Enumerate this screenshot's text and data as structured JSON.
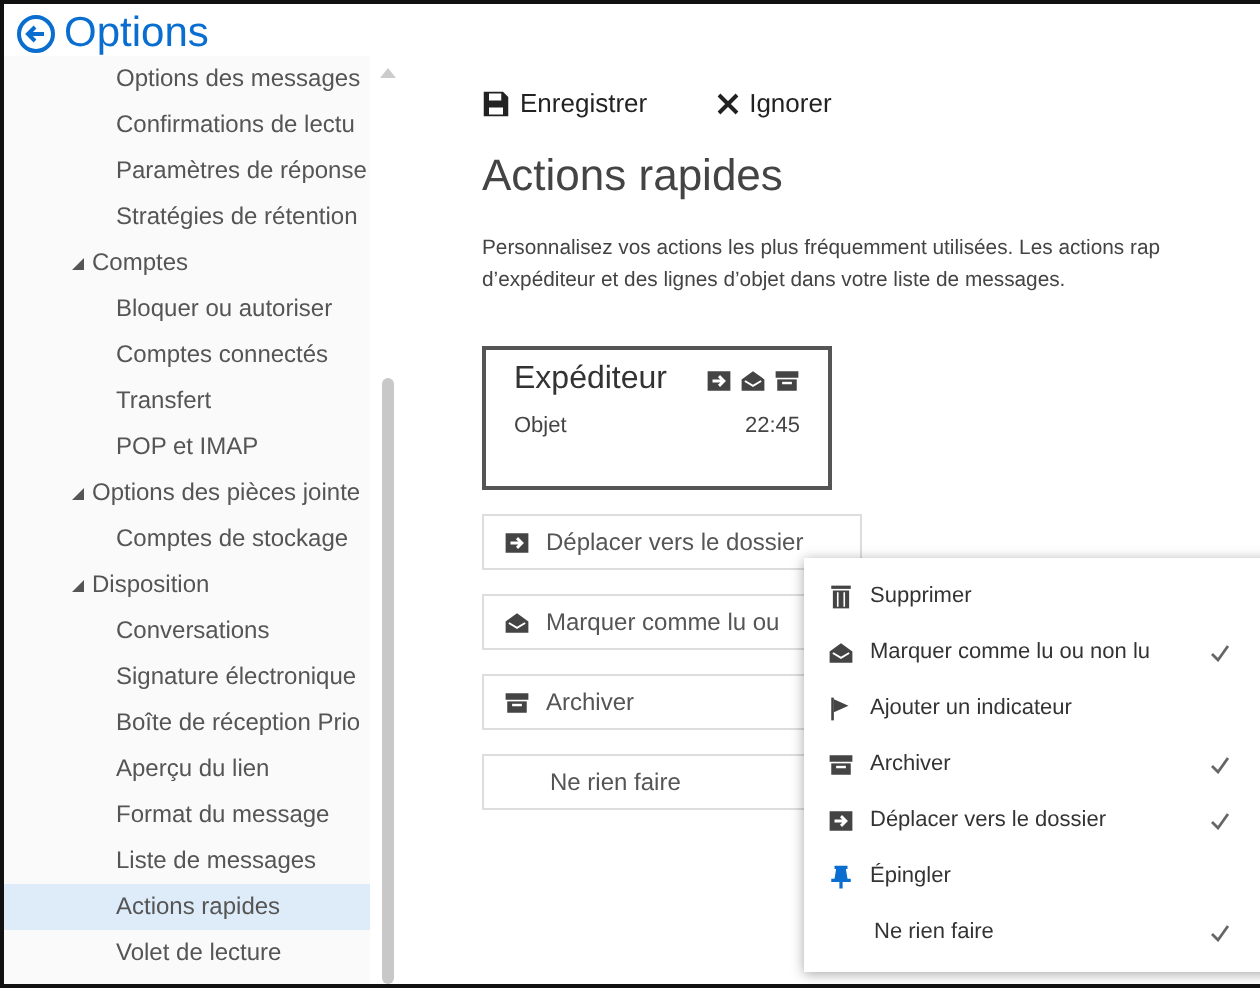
{
  "header": {
    "title": "Options"
  },
  "sidebar": {
    "items": [
      {
        "children": [
          {
            "label": "Options des messages",
            "selected": false
          },
          {
            "label": "Confirmations de lectu",
            "selected": false
          },
          {
            "label": "Paramètres de réponse",
            "selected": false
          },
          {
            "label": "Stratégies de rétention",
            "selected": false
          }
        ]
      },
      {
        "label": "Comptes",
        "expanded": true,
        "children": [
          {
            "label": "Bloquer ou autoriser",
            "selected": false
          },
          {
            "label": "Comptes connectés",
            "selected": false
          },
          {
            "label": "Transfert",
            "selected": false
          },
          {
            "label": "POP et IMAP",
            "selected": false
          }
        ]
      },
      {
        "label": "Options des pièces jointe",
        "expanded": true,
        "children": [
          {
            "label": "Comptes de stockage",
            "selected": false
          }
        ]
      },
      {
        "label": "Disposition",
        "expanded": true,
        "children": [
          {
            "label": "Conversations",
            "selected": false
          },
          {
            "label": "Signature électronique",
            "selected": false
          },
          {
            "label": "Boîte de réception Prio",
            "selected": false
          },
          {
            "label": "Aperçu du lien",
            "selected": false
          },
          {
            "label": "Format du message",
            "selected": false
          },
          {
            "label": "Liste de messages",
            "selected": false
          },
          {
            "label": "Actions rapides",
            "selected": true
          },
          {
            "label": "Volet de lecture",
            "selected": false
          }
        ]
      }
    ]
  },
  "toolbar": [
    {
      "kind": "save",
      "label": "Enregistrer"
    },
    {
      "kind": "discard",
      "label": "Ignorer"
    }
  ],
  "page_title": "Actions rapides",
  "description": [
    "Personnalisez vos actions les plus fréquemment utilisées. Les actions rap",
    "d’expéditeur et des lignes d’objet dans votre liste de messages."
  ],
  "preview": {
    "sender": "Expéditeur",
    "subject": "Objet",
    "time": "22:45",
    "actions": [
      {
        "kind": "move"
      },
      {
        "kind": "read"
      },
      {
        "kind": "archive"
      }
    ]
  },
  "action_selects": [
    {
      "kind": "move",
      "label": "Déplacer vers le dossier"
    },
    {
      "kind": "read",
      "label": "Marquer comme lu ou"
    },
    {
      "kind": "archive",
      "label": "Archiver"
    },
    {
      "kind": "none",
      "label": "Ne rien faire"
    }
  ],
  "menu": [
    {
      "kind": "delete",
      "label": "Supprimer",
      "checked": false
    },
    {
      "kind": "read",
      "label": "Marquer comme lu ou non lu",
      "checked": true
    },
    {
      "kind": "flag",
      "label": "Ajouter un indicateur",
      "checked": false
    },
    {
      "kind": "archive",
      "label": "Archiver",
      "checked": true
    },
    {
      "kind": "move",
      "label": "Déplacer vers le dossier",
      "checked": true
    },
    {
      "kind": "pin",
      "label": "Épingler",
      "checked": false
    },
    {
      "kind": "none",
      "label": "Ne rien faire",
      "checked": true
    }
  ]
}
